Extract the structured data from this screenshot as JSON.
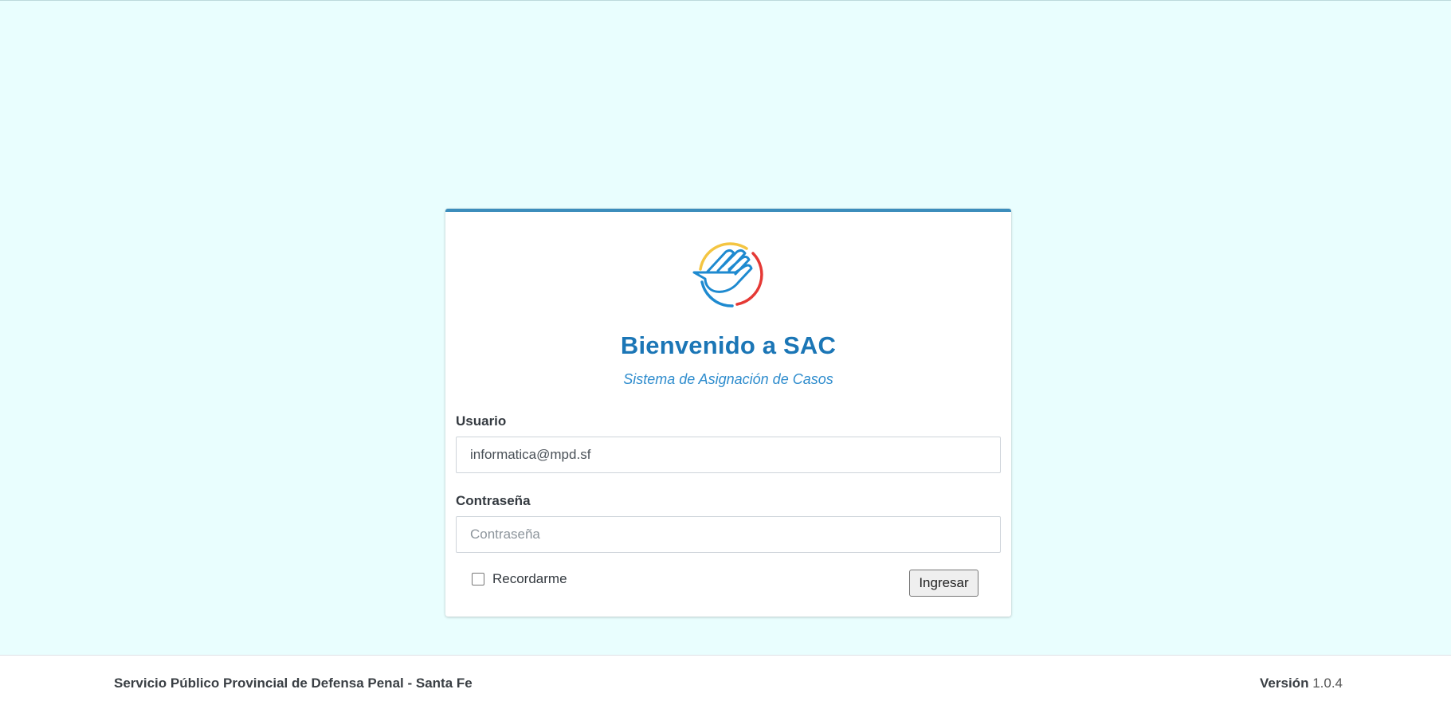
{
  "page": {
    "background_color": "#e9fefe",
    "accent_color": "#3c8dbc"
  },
  "login": {
    "logo_icon": "hand-logo-icon",
    "title": "Bienvenido a SAC",
    "subtitle": "Sistema de Asignación de Casos",
    "username_label": "Usuario",
    "username_value": "informatica@mpd.sf",
    "password_label": "Contraseña",
    "password_placeholder": "Contraseña",
    "password_value": "",
    "remember_label": "Recordarme",
    "remember_checked": false,
    "submit_label": "Ingresar",
    "title_color": "#1b76b6",
    "logo_colors": [
      "#f4c542",
      "#1e8ad0",
      "#e53935"
    ]
  },
  "footer": {
    "organization": "Servicio Público Provincial de Defensa Penal - Santa Fe",
    "version_label": "Versión",
    "version_number": "1.0.4"
  }
}
